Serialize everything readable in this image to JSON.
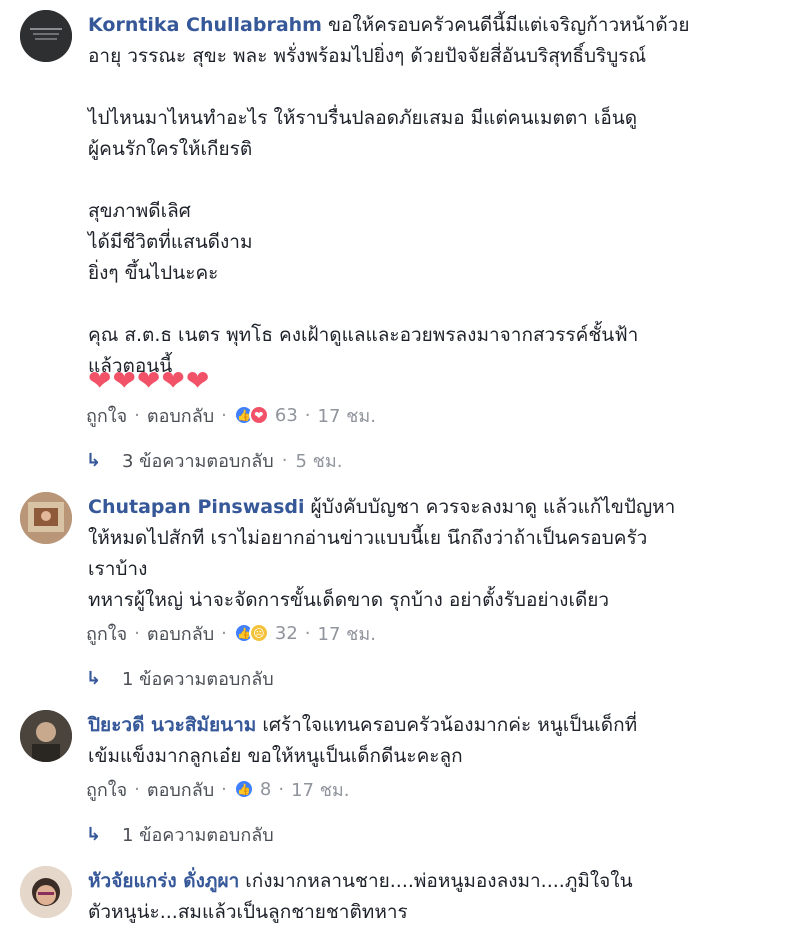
{
  "comments": [
    {
      "author": "Korntika Chullabrahm",
      "lines": [
        "ขอให้ครอบครัวคนดีนี้มีแต่เจริญก้าวหน้าด้วย",
        "อายุ วรรณะ สุขะ พละ พรั่งพร้อมไปยิ่งๆ ด้วยปัจจัยสี่อันบริสุทธิ์บริบูรณ์",
        "",
        "ไปไหนมาไหนทำอะไร ให้ราบรื่นปลอดภัยเสมอ มีแต่คนเมตตา เอ็นดู",
        "ผู้คนรักใครให้เกียรติ",
        "",
        "สุขภาพดีเลิศ",
        "ได้มีชีวิตที่แสนดีงาม",
        "ยิ่งๆ ขึ้นไปนะคะ",
        "",
        "คุณ ส.ต.ธ เนตร พุทโธ คงเฝ้าดูแลและอวยพรลงมาจากสวรรค์ชั้นฟ้า",
        "แล้วตอนนี้"
      ],
      "hearts": "❤❤❤❤❤",
      "like_label": "ถูกใจ",
      "reply_label": "ตอบกลับ",
      "reaction_count": "63",
      "time": "17 ชม.",
      "replies_text": "3 ข้อความตอบกลับ",
      "replies_time": "5 ชม."
    },
    {
      "author": "Chutapan Pinswasdi",
      "lines": [
        "ผู้บังคับบัญชา ควรจะลงมาดู แล้วแก้ไขปัญหา",
        "ให้หมดไปสักที เราไม่อยากอ่านข่าวแบบนี้เย นึกถึงว่าถ้าเป็นครอบครัว",
        "เราบ้าง",
        "ทหารผู้ใหญ่ น่าจะจัดการขั้นเด็ดขาด รุกบ้าง อย่าตั้งรับอย่างเดียว"
      ],
      "like_label": "ถูกใจ",
      "reply_label": "ตอบกลับ",
      "reaction_count": "32",
      "time": "17 ชม.",
      "replies_text": "1 ข้อความตอบกลับ"
    },
    {
      "author": "ปิยะวดี นวะสิมัยนาม",
      "lines": [
        "เศร้าใจแทนครอบครัวน้องมากค่ะ หนูเป็นเด็กที่",
        "เข้มแข็งมากลูกเอ๋ย ขอให้หนูเป็นเด็กดีนะคะลูก"
      ],
      "like_label": "ถูกใจ",
      "reply_label": "ตอบกลับ",
      "reaction_count": "8",
      "time": "17 ชม.",
      "replies_text": "1 ข้อความตอบกลับ"
    },
    {
      "author": "หัวจัยแกร่ง ดั่งภูผา",
      "lines": [
        "เก่งมากหลานชาย....พ่อหนูมองลงมา....ภูมิใจใน",
        "ตัวหนูน่ะ...สมแล้วเป็นลูกชายชาติทหาร"
      ]
    }
  ],
  "colors": {
    "author": "#365899",
    "meta": "#90949c",
    "like": "#4080ff",
    "love": "#f25268",
    "sad": "#f5c33b"
  },
  "icons": {
    "reply_arrow": "reply-arrow-icon",
    "like": "like-reaction-icon",
    "love": "love-reaction-icon",
    "sad": "sad-reaction-icon"
  }
}
